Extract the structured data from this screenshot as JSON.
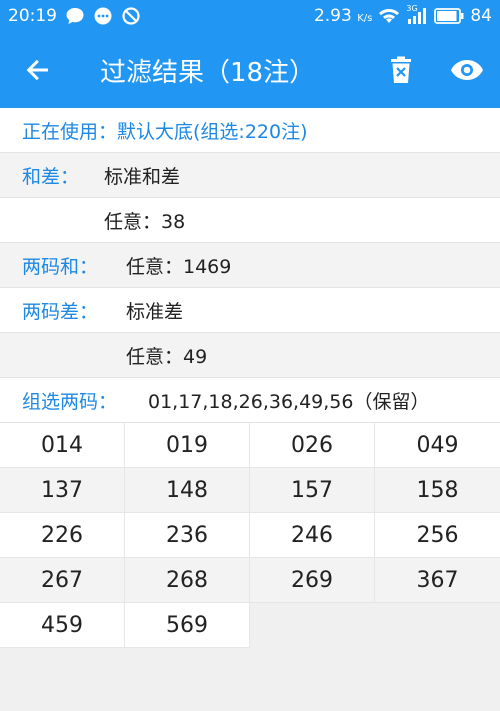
{
  "status_bar": {
    "time": "20:19",
    "net_speed": "2.93",
    "net_unit": "K/s",
    "net_type": "3G",
    "battery": "84",
    "icons": [
      "chat-bubble-icon",
      "message-icon",
      "do-not-disturb-icon",
      "wifi-icon",
      "signal-icon",
      "battery-icon"
    ]
  },
  "app_bar": {
    "title": "过滤结果（18注）",
    "back_icon": "arrow-left-icon",
    "delete_icon": "trash-icon",
    "view_icon": "eye-icon"
  },
  "filters": {
    "usage_label": "正在使用：",
    "usage_value": "默认大底(组选:220注)",
    "hecha_label": "和差：",
    "hecha_value": "标准和差",
    "hecha_any": "任意：38",
    "lmhe_label": "两码和：",
    "lmhe_value": "任意：1469",
    "lmcha_label": "两码差：",
    "lmcha_value": "标准差",
    "lmcha_any": "任意：49",
    "zxlm_label": "组选两码：",
    "zxlm_value": "01,17,18,26,36,49,56（保留）"
  },
  "results": [
    "014",
    "019",
    "026",
    "049",
    "137",
    "148",
    "157",
    "158",
    "226",
    "236",
    "246",
    "256",
    "267",
    "268",
    "269",
    "367",
    "459",
    "569"
  ],
  "colors": {
    "primary": "#2196F3",
    "label": "#1E88E5"
  }
}
